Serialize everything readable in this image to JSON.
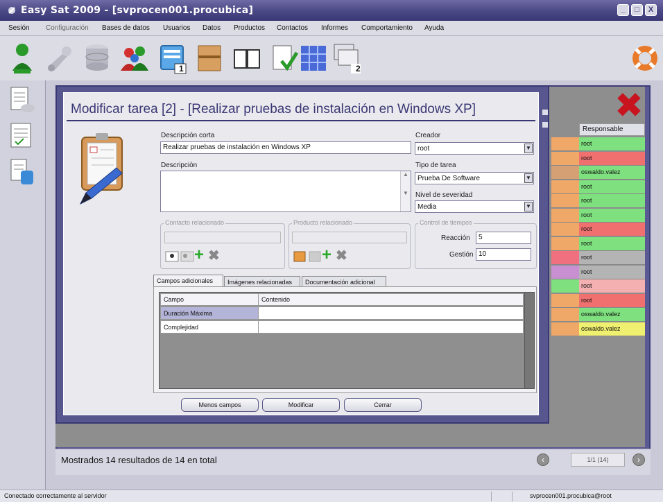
{
  "window": {
    "title": "Easy Sat 2009 - [svprocen001.procubica]",
    "buttons": [
      "minimize",
      "maximize",
      "close"
    ]
  },
  "menu": [
    "Sesión",
    "Configuración",
    "Bases de datos",
    "Usuarios",
    "Datos",
    "Productos",
    "Contactos",
    "Informes",
    "Comportamiento",
    "Ayuda"
  ],
  "toolbar": {
    "icons": [
      "user-icon",
      "wrench-icon",
      "database-icon",
      "users-icon",
      "window-1-icon",
      "box-icon",
      "book-icon",
      "checklist-icon",
      "network-icon",
      "window-2-icon",
      "lifebuoy-icon"
    ],
    "badges": {
      "window1": "1",
      "window2": "2"
    }
  },
  "sidebar": {
    "icons": [
      "task-list-icon",
      "notes-icon",
      "task-db-icon"
    ]
  },
  "grid": {
    "column_header": "Responsable",
    "rows": [
      {
        "responsable": "root",
        "color": "#7ee07e",
        "left": "#f0a868"
      },
      {
        "responsable": "root",
        "color": "#f07070",
        "left": "#f0a868"
      },
      {
        "responsable": "oswaldo.valez",
        "color": "#7ee07e",
        "left": "#d4a074"
      },
      {
        "responsable": "root",
        "color": "#7ee07e",
        "left": "#f0a868"
      },
      {
        "responsable": "root",
        "color": "#7ee07e",
        "left": "#f0a868"
      },
      {
        "responsable": "root",
        "color": "#7ee07e",
        "left": "#f0a868"
      },
      {
        "responsable": "root",
        "color": "#f07070",
        "left": "#f0a868"
      },
      {
        "responsable": "root",
        "color": "#7ee07e",
        "left": "#f0a868"
      },
      {
        "responsable": "root",
        "color": "#b4b4b4",
        "left": "#f07080"
      },
      {
        "responsable": "root",
        "color": "#b4b4b4",
        "left": "#c890d0"
      },
      {
        "responsable": "root",
        "color": "#f4b0b0",
        "left": "#7ee07e"
      },
      {
        "responsable": "root",
        "color": "#f07070",
        "left": "#f0a868"
      },
      {
        "responsable": "oswaldo.valez",
        "color": "#7ee07e",
        "left": "#f0a868"
      },
      {
        "responsable": "oswaldo.valez",
        "color": "#f0f070",
        "left": "#f0a868"
      }
    ]
  },
  "footer": {
    "results": "Mostrados 14 resultados de 14 en total",
    "pager": "1/1 (14)"
  },
  "dialog": {
    "title": "Modificar tarea [2] - [Realizar pruebas de instalación en Windows XP]",
    "desc_corta_label": "Descripción corta",
    "desc_corta_value": "Realizar pruebas de instalación en Windows XP",
    "descripcion_label": "Descripción",
    "descripcion_value": "",
    "creador_label": "Creador",
    "creador_value": "root",
    "tipo_label": "Tipo de tarea",
    "tipo_value": "Prueba De Software",
    "severidad_label": "Nivel de severidad",
    "severidad_value": "Media",
    "contacto_group": "Contacto relacionado",
    "producto_group": "Producto relacionado",
    "tiempos_group": "Control de tiempos",
    "reaccion_label": "Reacción",
    "reaccion_value": "5",
    "gestion_label": "Gestión",
    "gestion_value": "10",
    "tabs": [
      "Campos adicionales",
      "Imágenes relacionadas",
      "Documentación adicional"
    ],
    "campos": {
      "headers": [
        "Campo",
        "Contenido"
      ],
      "rows": [
        {
          "campo": "Duración Máxima",
          "contenido": ""
        },
        {
          "campo": "Complejidad",
          "contenido": ""
        }
      ]
    },
    "buttons": {
      "menos": "Menos campos",
      "modificar": "Modificar",
      "cerrar": "Cerrar"
    }
  },
  "status": {
    "left": "Conectado correctamente al servidor",
    "right": "svprocen001.procubica@root"
  },
  "colors": {
    "accent": "#3a3874",
    "titlebar": "#4a4785",
    "dialog_border": "#58568e"
  }
}
